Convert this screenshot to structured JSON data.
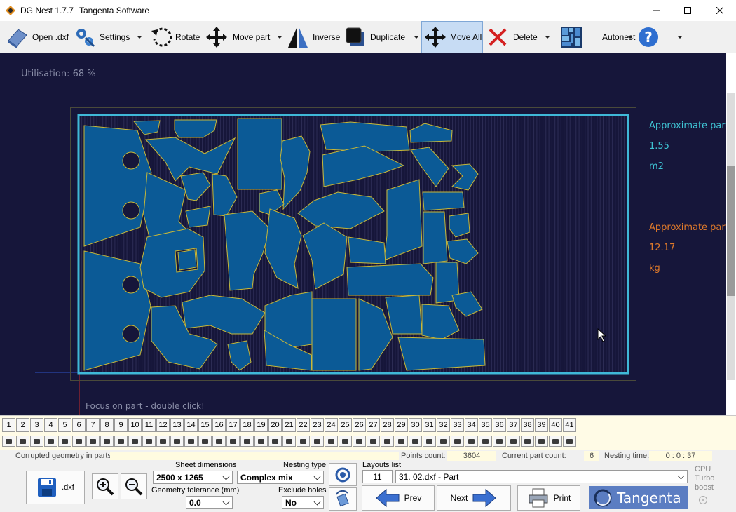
{
  "window": {
    "title": "DG Nest 1.7.7",
    "vendor": "Tangenta Software"
  },
  "toolbar": {
    "open_label": "Open .dxf",
    "settings_label": "Settings",
    "rotate_label": "Rotate",
    "move_part_label": "Move part",
    "inverse_label": "Inverse",
    "duplicate_label": "Duplicate",
    "move_all_label": "Move All",
    "delete_label": "Delete",
    "autonest_label": "Autonest"
  },
  "canvas": {
    "utilisation": "Utilisation: 68 %",
    "focus_hint": "Focus on part - double click!",
    "area_label": "Approximate part",
    "area_value": "1.55",
    "area_unit": "m2",
    "weight_label": "Approximate part",
    "weight_value": "12.17",
    "weight_unit": "kg",
    "colors": {
      "background": "#16163a",
      "sheet_border": "#3fb8d8",
      "part_fill": "#0b5a96",
      "part_stroke": "#c8b838"
    }
  },
  "layouts": [
    "1",
    "2",
    "3",
    "4",
    "5",
    "6",
    "7",
    "8",
    "9",
    "10",
    "11",
    "12",
    "13",
    "14",
    "15",
    "16",
    "17",
    "18",
    "19",
    "20",
    "21",
    "22",
    "23",
    "24",
    "25",
    "26",
    "27",
    "28",
    "29",
    "30",
    "31",
    "32",
    "33",
    "34",
    "35",
    "36",
    "37",
    "38",
    "39",
    "40",
    "41"
  ],
  "bottom": {
    "corrupted_label": "Corrupted geometry in parts:",
    "points_count_label": "Points count:",
    "points_count_value": "3604",
    "current_part_count_label": "Current part count:",
    "current_part_count_value": "6",
    "nesting_time_label": "Nesting time:",
    "nesting_time_value": "0 : 0 : 37",
    "save_dxf_label": ".dxf",
    "sheet_dimensions_label": "Sheet dimensions",
    "sheet_dimensions_value": "2500 x 1265",
    "geometry_tolerance_label": "Geometry tolerance (mm)",
    "geometry_tolerance_value": "0.0",
    "nesting_type_label": "Nesting type",
    "nesting_type_value": "Complex mix",
    "exclude_holes_label": "Exclude holes",
    "exclude_holes_value": "No",
    "layouts_list_label": "Layouts list",
    "layouts_list_index": "11",
    "layouts_list_value": "31. 02.dxf - Part",
    "prev_label": "Prev",
    "next_label": "Next",
    "print_label": "Print",
    "brand_label": "Tangenta",
    "cpu_label": "CPU",
    "turbo_label": "Turbo",
    "boost_label": "boost"
  }
}
